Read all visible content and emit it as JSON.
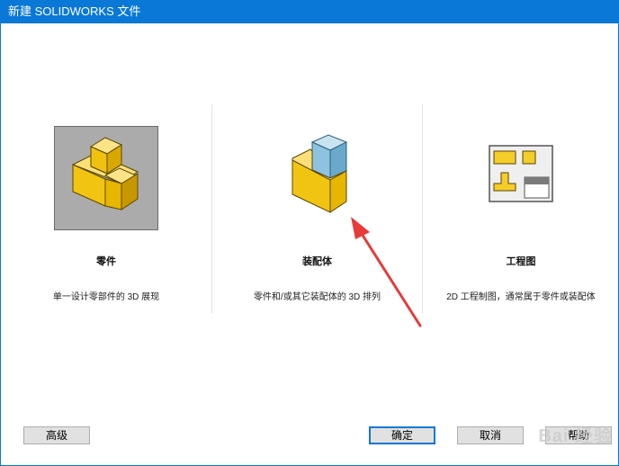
{
  "window": {
    "title": "新建 SOLIDWORKS 文件"
  },
  "options": [
    {
      "title": "零件",
      "description": "单一设计零部件的 3D 展现",
      "icon": "part-icon",
      "selected": true
    },
    {
      "title": "装配体",
      "description": "零件和/或其它装配体的 3D 排列",
      "icon": "assembly-icon",
      "selected": false
    },
    {
      "title": "工程图",
      "description": "2D 工程制图，通常属于零件或装配体",
      "icon": "drawing-icon",
      "selected": false
    }
  ],
  "buttons": {
    "advanced": "高级",
    "ok": "确定",
    "cancel": "取消",
    "help": "帮助"
  },
  "watermark": "Bai 经验",
  "colors": {
    "accent": "#0a78d7",
    "part_yellow": "#f5cd2a",
    "assembly_blue": "#8dc3e0",
    "annotation_arrow": "#e83a3a"
  }
}
